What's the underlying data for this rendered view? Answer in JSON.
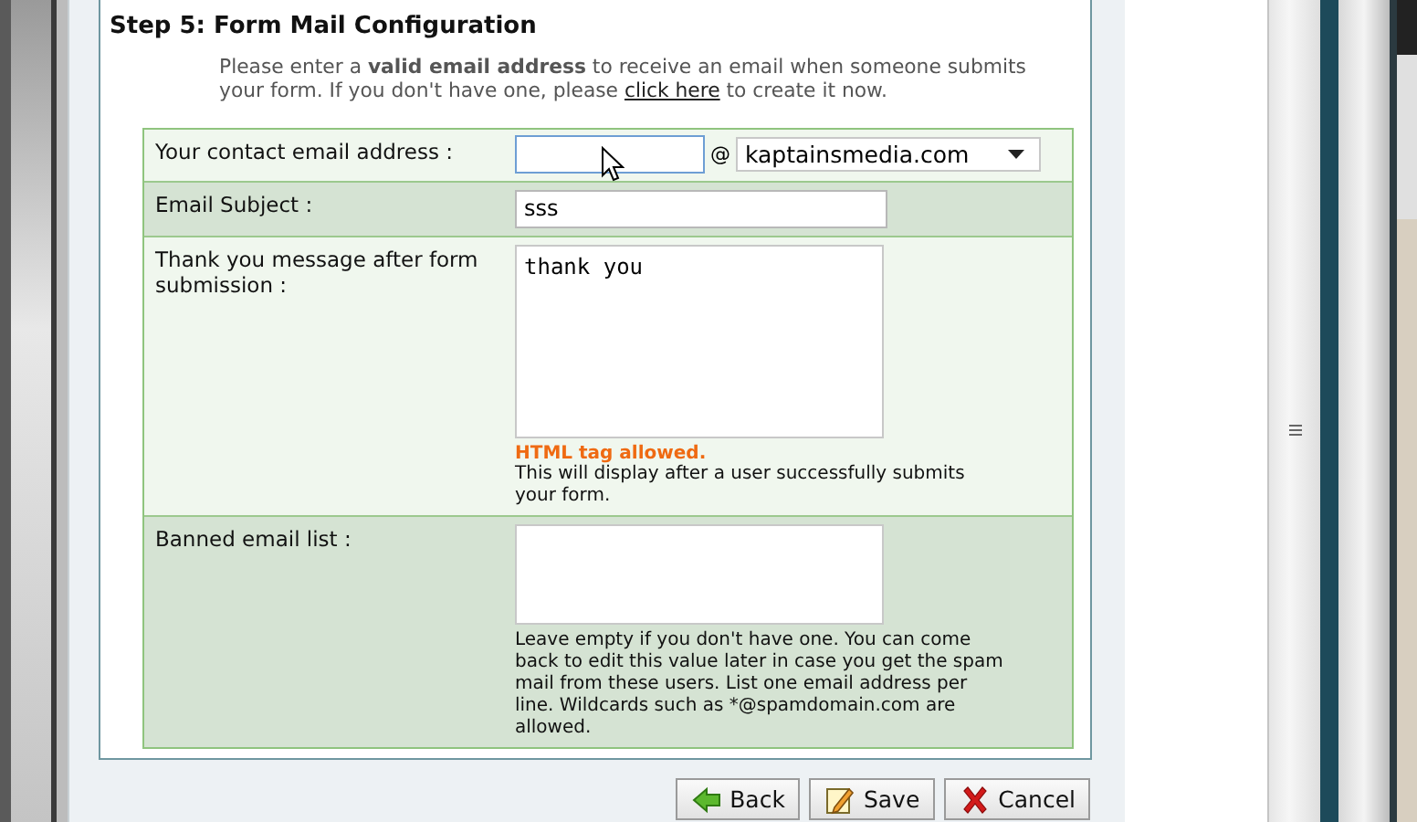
{
  "step_title": "Step 5: Form Mail Configuration",
  "intro": {
    "before": "Please enter a **valid email address** to receive an email when someone submits your form. If you don't have one, please ",
    "link": "click here",
    "after": " to create it now."
  },
  "fields": [
    {
      "kind": "email",
      "label": "Your contact email address :",
      "at": "@",
      "domain": "kaptainsmedia.com"
    },
    {
      "kind": "text",
      "label": "Email Subject :",
      "value": "sss"
    },
    {
      "kind": "textarea",
      "label": "Thank you message after form submission :",
      "value": "thank you",
      "note": "HTML tag allowed.",
      "help": "This will display after a user successfully submits your form."
    },
    {
      "kind": "textarea",
      "label": "Banned email list :",
      "help": "Leave empty if you don't have one. You can come back to edit this value later in case you get the spam mail from these users. List one email address per line. Wildcards such as *@spamdomain.com are allowed."
    }
  ],
  "buttons": [
    {
      "kind": "back",
      "label": "Back"
    },
    {
      "kind": "save",
      "label": "Save"
    },
    {
      "kind": "cancel",
      "label": "Cancel"
    }
  ]
}
